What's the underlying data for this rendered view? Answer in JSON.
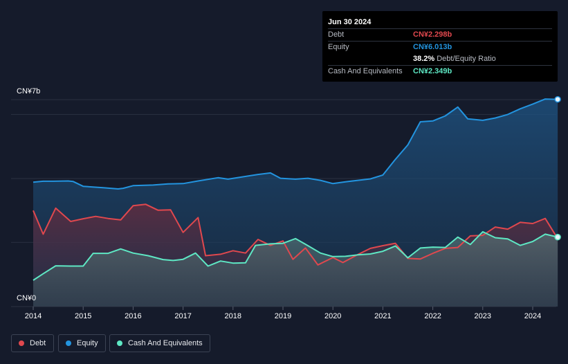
{
  "colors": {
    "debt": "#e0484e",
    "equity": "#2394df",
    "cash": "#5ee8c4",
    "background": "#151b2b"
  },
  "tooltip": {
    "date": "Jun 30 2024",
    "debt_label": "Debt",
    "debt_value": "CN¥2.298b",
    "equity_label": "Equity",
    "equity_value": "CN¥6.013b",
    "ratio_value": "38.2%",
    "ratio_label": "Debt/Equity Ratio",
    "cash_label": "Cash And Equivalents",
    "cash_value": "CN¥2.349b"
  },
  "legend": {
    "debt": "Debt",
    "equity": "Equity",
    "cash": "Cash And Equivalents"
  },
  "chart_data": {
    "type": "area",
    "y_top_label": "CN¥7b",
    "y_bottom_label": "CN¥0",
    "ylim": [
      0,
      7
    ],
    "xlim": [
      2014.0,
      2024.5
    ],
    "x_ticks": [
      "2014",
      "2015",
      "2016",
      "2017",
      "2018",
      "2019",
      "2020",
      "2021",
      "2022",
      "2023",
      "2024"
    ],
    "series": [
      {
        "name": "Equity",
        "x": [
          2014.0,
          2014.2,
          2014.4,
          2014.7,
          2014.8,
          2015.0,
          2015.4,
          2015.7,
          2015.8,
          2016.0,
          2016.4,
          2016.7,
          2017.0,
          2017.3,
          2017.7,
          2017.9,
          2018.2,
          2018.5,
          2018.75,
          2018.95,
          2019.25,
          2019.5,
          2019.75,
          2020.0,
          2020.25,
          2020.5,
          2020.75,
          2021.0,
          2021.25,
          2021.5,
          2021.75,
          2022.0,
          2022.25,
          2022.5,
          2022.7,
          2023.0,
          2023.25,
          2023.5,
          2023.75,
          2024.0,
          2024.25,
          2024.5
        ],
        "values": [
          4.21,
          4.24,
          4.24,
          4.25,
          4.23,
          4.07,
          4.02,
          3.98,
          4.0,
          4.09,
          4.11,
          4.15,
          4.16,
          4.25,
          4.36,
          4.31,
          4.39,
          4.47,
          4.52,
          4.34,
          4.31,
          4.34,
          4.27,
          4.16,
          4.22,
          4.27,
          4.32,
          4.45,
          4.98,
          5.47,
          6.25,
          6.28,
          6.45,
          6.75,
          6.35,
          6.3,
          6.38,
          6.5,
          6.69,
          6.85,
          7.02,
          7.01
        ]
      },
      {
        "name": "Debt",
        "x": [
          2014.0,
          2014.2,
          2014.45,
          2014.75,
          2015.0,
          2015.25,
          2015.5,
          2015.75,
          2016.0,
          2016.25,
          2016.5,
          2016.75,
          2017.0,
          2017.3,
          2017.45,
          2017.75,
          2018.0,
          2018.25,
          2018.5,
          2018.75,
          2019.0,
          2019.2,
          2019.45,
          2019.7,
          2020.0,
          2020.2,
          2020.5,
          2020.75,
          2021.0,
          2021.25,
          2021.5,
          2021.75,
          2022.0,
          2022.25,
          2022.5,
          2022.75,
          2023.0,
          2023.25,
          2023.5,
          2023.75,
          2024.0,
          2024.25,
          2024.5
        ],
        "values": [
          3.25,
          2.45,
          3.33,
          2.88,
          2.97,
          3.05,
          2.98,
          2.93,
          3.41,
          3.46,
          3.26,
          3.27,
          2.51,
          3.01,
          1.72,
          1.77,
          1.89,
          1.81,
          2.27,
          2.07,
          2.22,
          1.6,
          1.98,
          1.41,
          1.66,
          1.49,
          1.76,
          1.97,
          2.06,
          2.14,
          1.63,
          1.61,
          1.8,
          1.97,
          2.0,
          2.39,
          2.41,
          2.69,
          2.62,
          2.85,
          2.81,
          2.98,
          2.3
        ]
      },
      {
        "name": "Cash And Equivalents",
        "x": [
          2014.0,
          2014.2,
          2014.45,
          2014.75,
          2015.0,
          2015.2,
          2015.5,
          2015.75,
          2016.0,
          2016.3,
          2016.6,
          2016.8,
          2017.0,
          2017.25,
          2017.5,
          2017.75,
          2018.0,
          2018.25,
          2018.45,
          2018.75,
          2019.0,
          2019.25,
          2019.5,
          2019.75,
          2020.0,
          2020.25,
          2020.5,
          2020.75,
          2021.0,
          2021.25,
          2021.5,
          2021.75,
          2022.0,
          2022.25,
          2022.5,
          2022.75,
          2023.0,
          2023.25,
          2023.5,
          2023.75,
          2024.0,
          2024.25,
          2024.5
        ],
        "values": [
          0.89,
          1.11,
          1.38,
          1.37,
          1.37,
          1.8,
          1.8,
          1.95,
          1.81,
          1.72,
          1.59,
          1.56,
          1.6,
          1.81,
          1.37,
          1.54,
          1.47,
          1.48,
          2.07,
          2.12,
          2.14,
          2.3,
          2.06,
          1.81,
          1.69,
          1.7,
          1.75,
          1.78,
          1.87,
          2.05,
          1.65,
          1.98,
          2.01,
          2.0,
          2.35,
          2.1,
          2.53,
          2.33,
          2.29,
          2.07,
          2.2,
          2.45,
          2.35
        ]
      }
    ]
  }
}
